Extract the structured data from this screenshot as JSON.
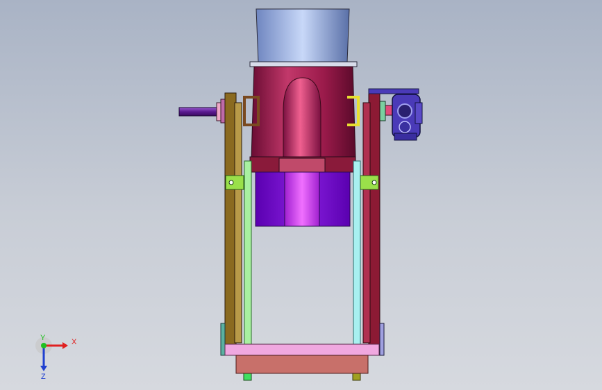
{
  "viewport": {
    "background_top": "#a9b3c5",
    "background_bottom": "#d6d9df"
  },
  "model": {
    "colors": {
      "hopper_top": "#8ea6d8",
      "hopper_body": "#9c1f4e",
      "hopper_dark": "#5b0d2b",
      "chute_purple": "#7a10d0",
      "chute_center": "#d040f0",
      "frame_left": "#8a6a20",
      "frame_right": "#8c1a34",
      "guide_green": "#a8f0a0",
      "guide_cyan": "#a8f0f0",
      "base_pink": "#f0a8e0",
      "base_salmon": "#c8706a",
      "shaft": "#6a2aa0",
      "motor": "#4a3ab8",
      "bracket_yellow": "#e8e030",
      "clamp_green": "#9ae04a"
    }
  },
  "triad": {
    "x_label": "X",
    "y_label": "Y",
    "z_label": "Z",
    "x_color": "#e02020",
    "y_color": "#20c020",
    "z_color": "#2040d0"
  }
}
